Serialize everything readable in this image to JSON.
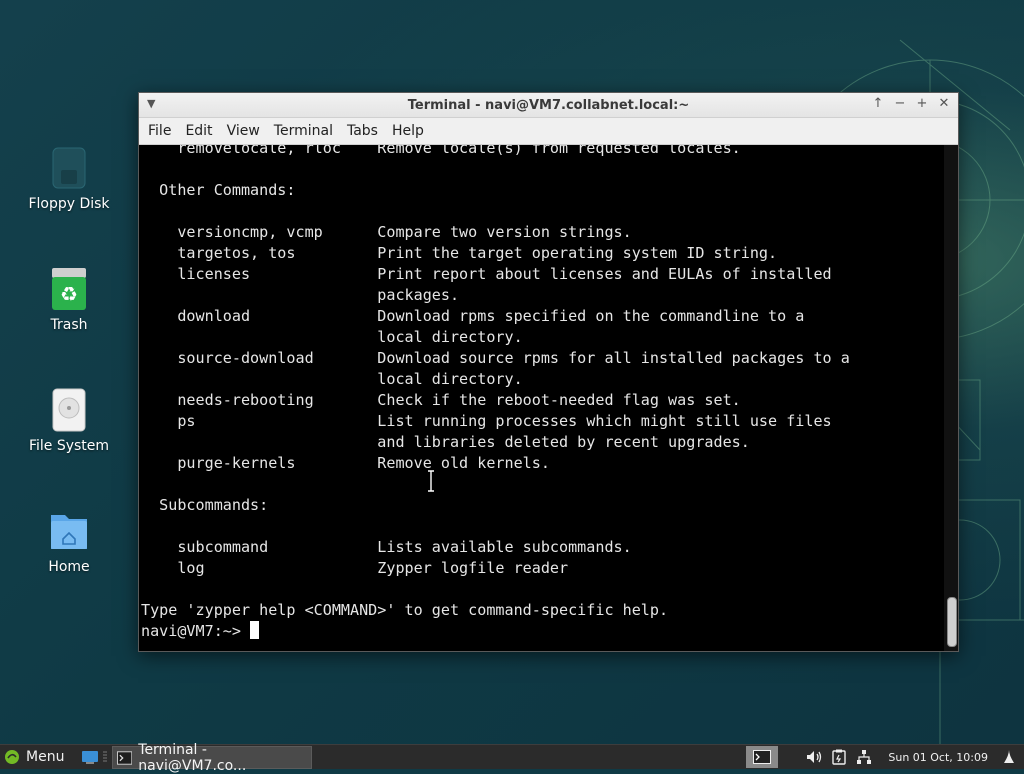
{
  "desktop": {
    "icons": [
      {
        "label": "Floppy Disk",
        "icon": "floppy-disk-icon"
      },
      {
        "label": "Trash",
        "icon": "trash-icon"
      },
      {
        "label": "File System",
        "icon": "hard-drive-icon"
      },
      {
        "label": "Home",
        "icon": "home-folder-icon"
      }
    ]
  },
  "window": {
    "title": "Terminal - navi@VM7.collabnet.local:~",
    "controls": [
      "window-menu-icon",
      "shade-icon",
      "minimize-icon",
      "maximize-icon",
      "close-icon"
    ],
    "menu": [
      "File",
      "Edit",
      "View",
      "Terminal",
      "Tabs",
      "Help"
    ]
  },
  "terminal": {
    "lines": [
      "    removelocale, rloc    Remove locale(s) from requested locales.",
      "",
      "  Other Commands:",
      "",
      "    versioncmp, vcmp      Compare two version strings.",
      "    targetos, tos         Print the target operating system ID string.",
      "    licenses              Print report about licenses and EULAs of installed",
      "                          packages.",
      "    download              Download rpms specified on the commandline to a",
      "                          local directory.",
      "    source-download       Download source rpms for all installed packages to a",
      "                          local directory.",
      "    needs-rebooting       Check if the reboot-needed flag was set.",
      "    ps                    List running processes which might still use files",
      "                          and libraries deleted by recent upgrades.",
      "    purge-kernels         Remove old kernels.",
      "",
      "  Subcommands:",
      "",
      "    subcommand            Lists available subcommands.",
      "    log                   Zypper logfile reader",
      "",
      "Type 'zypper help <COMMAND>' to get command-specific help."
    ],
    "prompt": "navi@VM7:~> "
  },
  "taskbar": {
    "menu_label": "Menu",
    "task_label": "Terminal - navi@VM7.co...",
    "clock": "Sun 01 Oct, 10:09",
    "tray_icons": [
      "terminal-tray-icon",
      "volume-icon",
      "clipboard-icon",
      "network-icon",
      "power-icon"
    ]
  },
  "colors": {
    "desktop_bg": "#0f3a45",
    "terminal_bg": "#000000",
    "terminal_fg": "#e6e6e6",
    "taskbar_bg": "#2b2b2b",
    "accent_green": "#73ba25"
  }
}
